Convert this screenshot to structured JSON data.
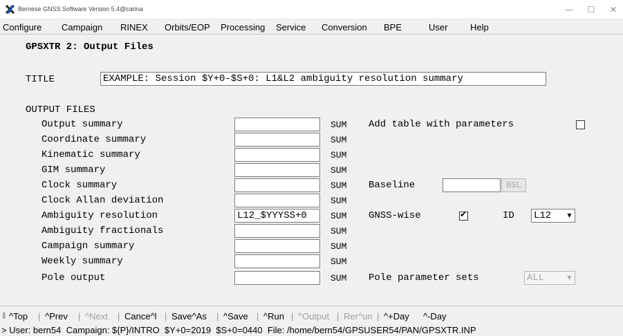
{
  "window": {
    "title": "Bernese GNSS Software Version 5.4@carina",
    "icon": "x-logo-icon",
    "controls": {
      "minimize": "—",
      "maximize": "☐",
      "close": "✕"
    }
  },
  "menu": {
    "items": [
      "Configure",
      "Campaign",
      "RINEX",
      "Orbits/EOP",
      "Processing",
      "Service",
      "Conversion",
      "BPE",
      "User",
      "Help"
    ]
  },
  "panel": {
    "heading": "GPSXTR 2: Output Files",
    "title_label": "TITLE",
    "title_value": "EXAMPLE: Session $Y+0-$S+0: L1&L2 ambiguity resolution summary",
    "output_files_label": "OUTPUT FILES",
    "ext": "SUM",
    "rows": [
      {
        "label": "Output summary",
        "value": ""
      },
      {
        "label": "Coordinate summary",
        "value": ""
      },
      {
        "label": "Kinematic summary",
        "value": ""
      },
      {
        "label": "GIM summary",
        "value": ""
      },
      {
        "label": "Clock summary",
        "value": ""
      },
      {
        "label": "Clock Allan deviation",
        "value": ""
      },
      {
        "label": "Ambiguity resolution",
        "value": "L12_$YYYSS+0"
      },
      {
        "label": "Ambiguity fractionals",
        "value": ""
      },
      {
        "label": "Campaign summary",
        "value": ""
      },
      {
        "label": "Weekly summary",
        "value": ""
      },
      {
        "label": "Pole output",
        "value": ""
      }
    ],
    "add_table_label": "Add table with parameters",
    "add_table_checked": false,
    "baseline_label": "Baseline",
    "baseline_value": "",
    "baseline_button": "BSL",
    "gnss_wise_label": "GNSS-wise",
    "gnss_wise_checked": true,
    "id_label": "ID",
    "id_value": "L12",
    "pole_sets_label": "Pole parameter sets",
    "pole_sets_value": "ALL"
  },
  "toolbar": {
    "buttons": [
      {
        "label": "^Top",
        "enabled": true
      },
      {
        "label": "^Prev",
        "enabled": true
      },
      {
        "label": "^Next",
        "enabled": false
      },
      {
        "label": "Cance^l",
        "enabled": true
      },
      {
        "label": "Save^As",
        "enabled": true
      },
      {
        "label": "^Save",
        "enabled": true
      },
      {
        "label": "^Run",
        "enabled": true
      },
      {
        "label": "^Output",
        "enabled": false
      },
      {
        "label": "Rer^un",
        "enabled": false
      },
      {
        "label": "^+Day",
        "enabled": true
      },
      {
        "label": "^-Day",
        "enabled": true
      }
    ]
  },
  "status": {
    "text": "> User: bern54  Campaign: ${P}/INTRO  $Y+0=2019  $S+0=0440  File: /home/bern54/GPSUSER54/PAN/GPSXTR.INP"
  }
}
